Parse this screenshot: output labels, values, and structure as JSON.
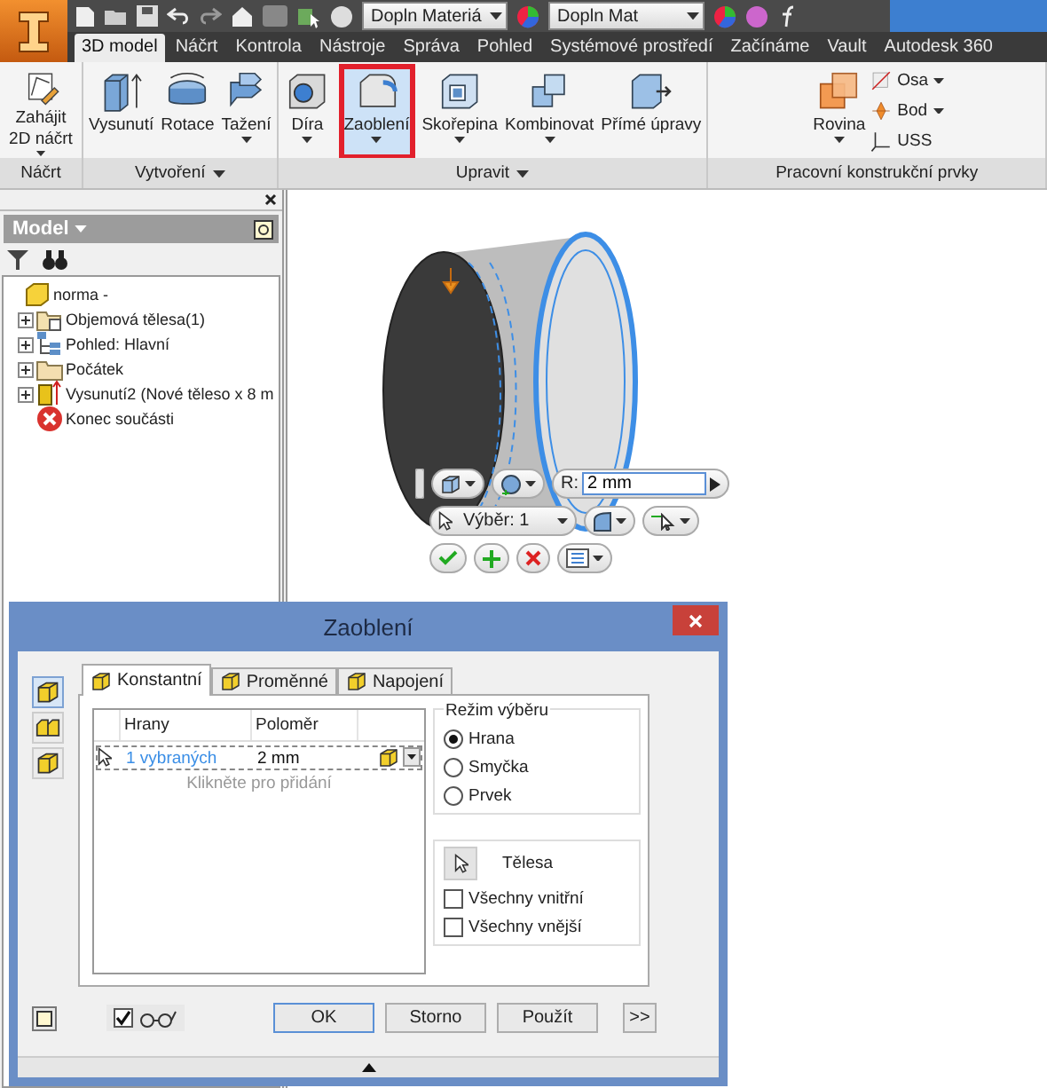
{
  "quick_access": {
    "dropdowns": [
      "Dopln Materiá",
      "Dopln Mat"
    ]
  },
  "ribbon_tabs": [
    {
      "label": "3D model",
      "selected": true
    },
    {
      "label": "Náčrt",
      "selected": false
    },
    {
      "label": "Kontrola",
      "selected": false
    },
    {
      "label": "Nástroje",
      "selected": false
    },
    {
      "label": "Správa",
      "selected": false
    },
    {
      "label": "Pohled",
      "selected": false
    },
    {
      "label": "Systémové prostředí",
      "selected": false
    },
    {
      "label": "Začínáme",
      "selected": false
    },
    {
      "label": "Vault",
      "selected": false
    },
    {
      "label": "Autodesk 360",
      "selected": false
    }
  ],
  "ribbon_panels": [
    {
      "label": "Náčrt",
      "menu": false,
      "buttons": [
        {
          "kind": "sketch",
          "label": "Zahájit 2D náčrt",
          "dropdown": true,
          "highlighted": false
        }
      ]
    },
    {
      "label": "Vytvoření",
      "menu": true,
      "buttons": [
        {
          "kind": "extrude",
          "label": "Vysunutí",
          "dropdown": false,
          "highlighted": false
        },
        {
          "kind": "revolve",
          "label": "Rotace",
          "dropdown": false,
          "highlighted": false
        },
        {
          "kind": "sweep",
          "label": "Tažení",
          "dropdown": true,
          "highlighted": false
        }
      ]
    },
    {
      "label": "Upravit",
      "menu": true,
      "buttons": [
        {
          "kind": "hole",
          "label": "Díra",
          "dropdown": true,
          "highlighted": false
        },
        {
          "kind": "fillet",
          "label": "Zaoblení",
          "dropdown": true,
          "highlighted": true
        },
        {
          "kind": "shell",
          "label": "Skořepina",
          "dropdown": true,
          "highlighted": false
        },
        {
          "kind": "combine",
          "label": "Kombinovat",
          "dropdown": true,
          "highlighted": false
        },
        {
          "kind": "direct",
          "label": "Přímé úpravy",
          "dropdown": false,
          "highlighted": false
        }
      ]
    },
    {
      "label": "Pracovní konstrukční prvky",
      "menu": false,
      "buttons": [
        {
          "kind": "plane",
          "label": "Rovina",
          "dropdown": true,
          "highlighted": false
        }
      ],
      "small_buttons": [
        {
          "kind": "axis",
          "label": "Osa",
          "dropdown": true
        },
        {
          "kind": "point",
          "label": "Bod",
          "dropdown": true
        },
        {
          "kind": "ucs",
          "label": "USS",
          "dropdown": false
        }
      ]
    }
  ],
  "browser": {
    "title": "Model",
    "tree": [
      {
        "kind": "part",
        "label": "norma -",
        "children": [
          {
            "kind": "bodies",
            "label": "Objemová tělesa(1)",
            "expanded": false
          },
          {
            "kind": "view",
            "label": "Pohled: Hlavní",
            "expanded": false
          },
          {
            "kind": "folder",
            "label": "Počátek",
            "expanded": false
          },
          {
            "kind": "extrude",
            "label": "Vysunutí2 (Nové těleso x 8 m",
            "expanded": false
          },
          {
            "kind": "end",
            "label": "Konec součásti"
          }
        ]
      }
    ]
  },
  "mini_toolbar": {
    "radius_label": "R:",
    "radius_value": "2 mm",
    "selection": "Výběr: 1"
  },
  "dialog": {
    "title": "Zaoblení",
    "side_modes": [
      {
        "kind": "edge",
        "selected": true
      },
      {
        "kind": "face",
        "selected": false
      },
      {
        "kind": "full",
        "selected": false
      }
    ],
    "tabs": [
      {
        "label": "Konstantní",
        "selected": true
      },
      {
        "label": "Proměnné",
        "selected": false
      },
      {
        "label": "Napojení",
        "selected": false
      }
    ],
    "table": {
      "columns": [
        "Hrany",
        "Poloměr"
      ],
      "rows": [
        {
          "edges": "1 vybraných",
          "radius": "2 mm"
        }
      ],
      "add_hint": "Klikněte pro přidání"
    },
    "selection_mode": {
      "title": "Režim výběru",
      "options": [
        {
          "label": "Hrana",
          "selected": true
        },
        {
          "label": "Smyčka",
          "selected": false
        },
        {
          "label": "Prvek",
          "selected": false
        }
      ]
    },
    "bodies": {
      "label": "Tělesa",
      "options": [
        {
          "label": "Všechny vnitřní",
          "checked": false
        },
        {
          "label": "Všechny vnější",
          "checked": false
        }
      ]
    },
    "preview": {
      "checked": true
    },
    "buttons": [
      "OK",
      "Storno",
      "Použít"
    ],
    "more": ">>"
  }
}
